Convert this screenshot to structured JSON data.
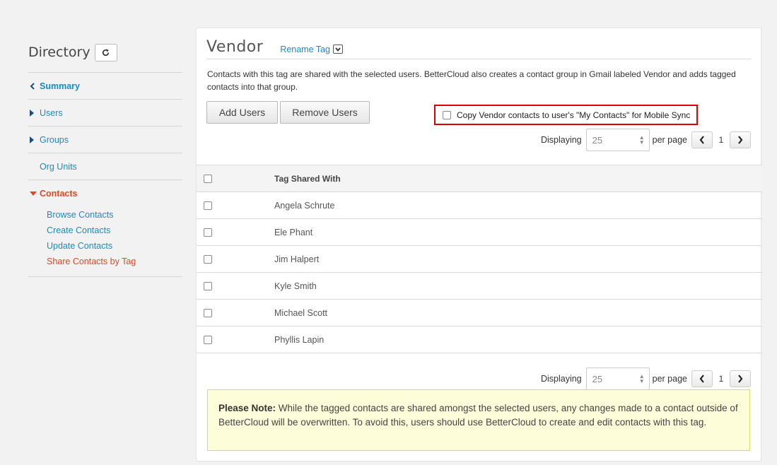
{
  "sidebar": {
    "title": "Directory",
    "refresh_icon": "refresh-icon",
    "items": [
      {
        "label": "Summary"
      },
      {
        "label": "Users"
      },
      {
        "label": "Groups"
      },
      {
        "label": "Org Units"
      },
      {
        "label": "Contacts"
      }
    ],
    "contacts_sub": [
      {
        "label": "Browse Contacts"
      },
      {
        "label": "Create Contacts"
      },
      {
        "label": "Update Contacts"
      },
      {
        "label": "Share Contacts by Tag"
      }
    ]
  },
  "main": {
    "tag_name": "Vendor",
    "rename_label": "Rename Tag",
    "description": "Contacts with this tag are shared with the selected users. BetterCloud also creates a contact group in Gmail labeled Vendor and adds tagged contacts into that group.",
    "add_users": "Add Users",
    "remove_users": "Remove Users",
    "sync_label": "Copy Vendor contacts to user's \"My Contacts\" for Mobile Sync",
    "pager": {
      "displaying": "Displaying",
      "per_page_value": "25",
      "per_page": "per page",
      "page": "1"
    },
    "table": {
      "header": "Tag Shared With",
      "rows": [
        "Angela Schrute",
        "Ele Phant",
        "Jim Halpert",
        "Kyle Smith",
        "Michael Scott",
        "Phyllis Lapin"
      ]
    },
    "note": {
      "bold": "Please Note:",
      "text": " While the tagged contacts are shared amongst the selected users, any changes made to a contact outside of BetterCloud will be overwritten. To avoid this, users should use BetterCloud to create and edit contacts with this tag."
    }
  },
  "colors": {
    "link": "#1a8bc4",
    "active_section": "#e04726",
    "highlight_box": "#e00000",
    "note_bg": "#fefdd9"
  }
}
